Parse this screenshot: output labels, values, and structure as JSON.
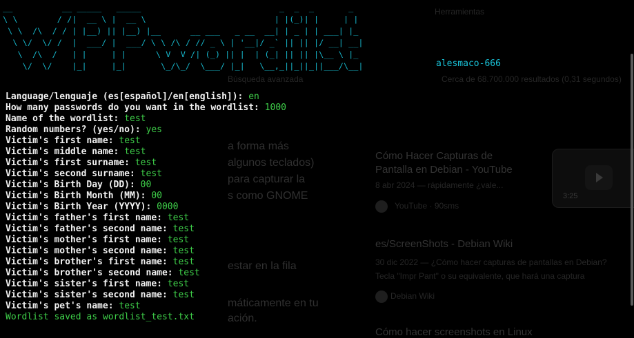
{
  "banner": {
    "art": "__          __ _____   _____                            _  _  _       _   \n\\ \\        / /|  __ \\ |  __ \\                          | |(_)| |     | |  \n \\ \\  /\\  / / | |__) || |__) |__      __ ___   _ __  __| | _ | | ___| |_ \n  \\ \\/  \\/ /  |  ___/ |  ___/ \\ \\ /\\ / // _ \\ | '__|/ _` || || |/ __| __|\n   \\  /\\  /   | |     | |      \\ V  V /| (_) || |  | (_| || || |\\__ \\ |_ \n    \\/  \\/    |_|     |_|       \\_/\\_/  \\___/ |_|   \\__,_||_||_||___/\\__|",
    "author": "alesmaco-666"
  },
  "terminal": {
    "lines": [
      {
        "q": "Language/lenguaje (es[español]/en[english]): ",
        "a": "en"
      },
      {
        "q": "How many passwords do you want in the wordlist: ",
        "a": "1000"
      },
      {
        "q": "Name of the wordlist: ",
        "a": "test"
      },
      {
        "q": "Random numbers? (yes/no): ",
        "a": "yes"
      },
      {
        "q": "Victim's first name: ",
        "a": "test"
      },
      {
        "q": "Victim's middle name: ",
        "a": "test"
      },
      {
        "q": "Victim's first surname: ",
        "a": "test"
      },
      {
        "q": "Victim's second surname: ",
        "a": "test"
      },
      {
        "q": "Victim's Birth Day (DD): ",
        "a": "00"
      },
      {
        "q": "Victim's Birth Month (MM): ",
        "a": "00"
      },
      {
        "q": "Victim's Birth Year (YYYY): ",
        "a": "0000"
      },
      {
        "q": "Victim's father's first name: ",
        "a": "test"
      },
      {
        "q": "Victim's father's second name: ",
        "a": "test"
      },
      {
        "q": "Victim's mother's first name: ",
        "a": "test"
      },
      {
        "q": "Victim's mother's second name: ",
        "a": "test"
      },
      {
        "q": "Victim's brother's first name: ",
        "a": "test"
      },
      {
        "q": "Victim's brother's second name: ",
        "a": "test"
      },
      {
        "q": "Victim's sister's first name: ",
        "a": "test"
      },
      {
        "q": "Victim's sister's second name: ",
        "a": "test"
      },
      {
        "q": "Victim's pet's name: ",
        "a": "test"
      }
    ],
    "result": "Wordlist saved as wordlist_test.txt"
  },
  "background": {
    "top_right_label": "Herramientas",
    "stats": "Cerca de 68.700.000 resultados (0,31 segundos)",
    "advanced": "Búsqueda avanzada",
    "snippet_lines": [
      "a forma más",
      "algunos teclados)",
      "para capturar la",
      "s como GNOME"
    ],
    "snippet2": "estar en la fila",
    "snippet3": [
      "máticamente en tu",
      "ación."
    ],
    "results": [
      {
        "title": "Cómo Hacer Capturas de",
        "title2": "Pantalla en Debian - YouTube",
        "meta": "8 abr 2024 — rápidamente ¿vale...",
        "source": "YouTube · 90sms",
        "duration": "3:25"
      },
      {
        "title": "es/ScreenShots - Debian Wiki",
        "meta": "30 dic 2022 — ¿Cómo hacer capturas de pantallas en Debian?",
        "meta2": "Tecla \"Impr Pant\" o su equivalente, que hará una captura",
        "source": "Debian Wiki"
      },
      {
        "title": "Cómo hacer screenshots en Linux"
      }
    ]
  },
  "colors": {
    "background": "#000000",
    "banner": "#16b3c7",
    "answer": "#3fd14a",
    "question": "#f2f2f2"
  }
}
